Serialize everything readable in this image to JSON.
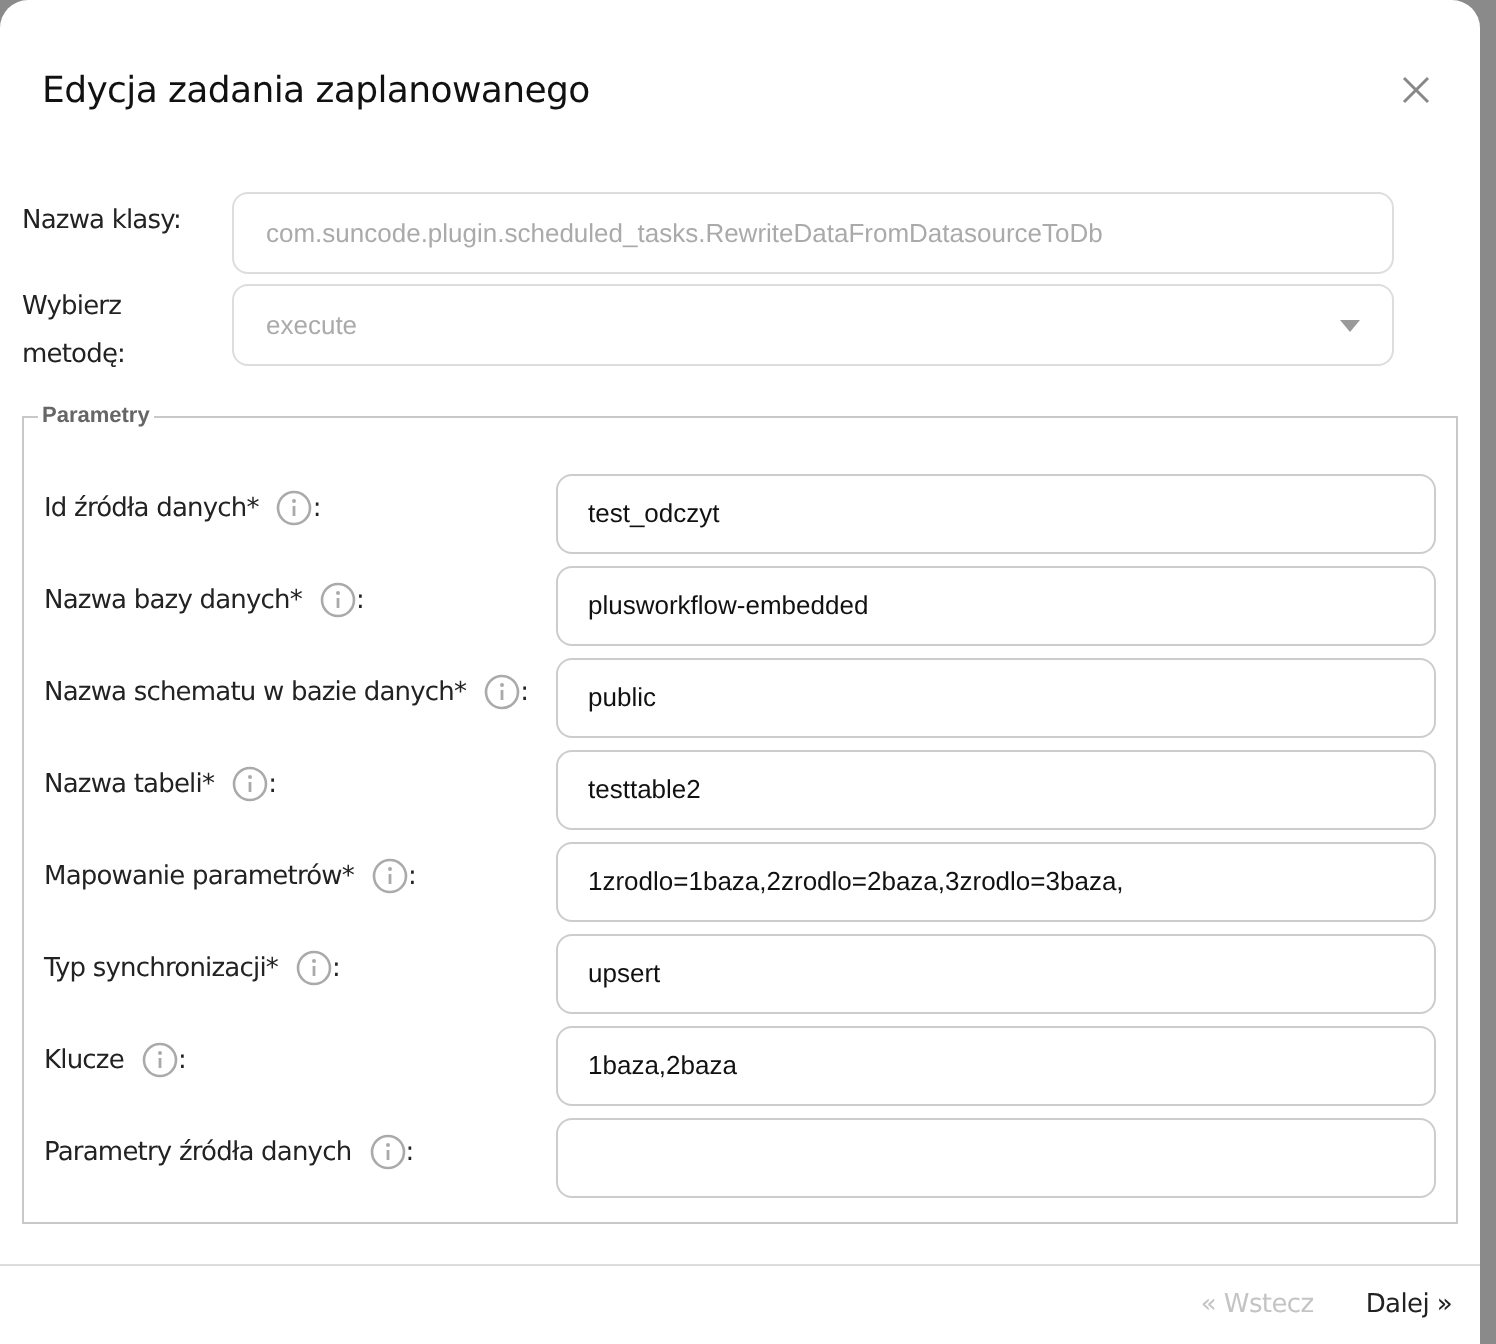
{
  "dialog": {
    "title": "Edycja zadania zaplanowanego"
  },
  "fields": [
    {
      "kind": "text",
      "label": "Nazwa klasy:",
      "value": "com.suncode.plugin.scheduled_tasks.RewriteDataFromDatasourceToDb",
      "disabled": true
    },
    {
      "kind": "select",
      "label": "Wybierz metodę:",
      "value": "execute",
      "disabled": true
    }
  ],
  "parameters": {
    "legend": "Parametry",
    "rows": [
      {
        "label": "Id źródła danych*",
        "colon": ":",
        "value": "test_odczyt"
      },
      {
        "label": "Nazwa bazy danych*",
        "colon": ":",
        "value": "plusworkflow-embedded"
      },
      {
        "label": "Nazwa schematu w bazie danych*",
        "colon": ":",
        "value": "public"
      },
      {
        "label": "Nazwa tabeli*",
        "colon": ":",
        "value": "testtable2"
      },
      {
        "label": "Mapowanie parametrów*",
        "colon": ":",
        "value": "1zrodlo=1baza,2zrodlo=2baza,3zrodlo=3baza,"
      },
      {
        "label": "Typ synchronizacji*",
        "colon": ":",
        "value": "upsert"
      },
      {
        "label": "Klucze",
        "colon": ":",
        "value": "1baza,2baza"
      },
      {
        "label": "Parametry źródła danych",
        "colon": ":",
        "value": ""
      }
    ]
  },
  "footer": {
    "buttons": [
      {
        "label": "« Wstecz",
        "disabled": true
      },
      {
        "label": "Dalej »",
        "disabled": false
      }
    ]
  }
}
